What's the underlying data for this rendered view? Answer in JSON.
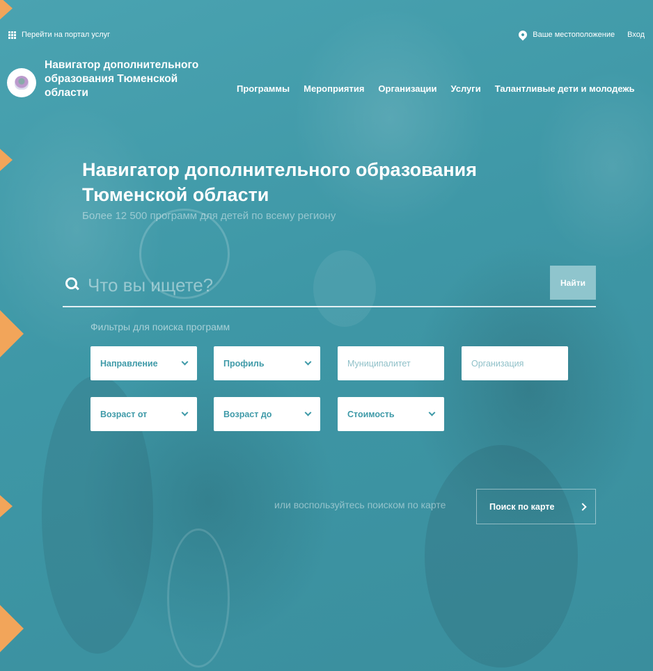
{
  "topbar": {
    "portal_link": "Перейти на портал услуг",
    "location": "Ваше местоположение",
    "login": "Вход"
  },
  "header": {
    "brand": "Навигатор дополнительного образования Тюменской области",
    "nav": [
      "Программы",
      "Мероприятия",
      "Организации",
      "Услуги",
      "Талантливые дети и молодежь"
    ]
  },
  "hero": {
    "title": "Навигатор дополнительного образования Тюменской области",
    "subtitle": "Более 12 500 программ для детей по всему региону"
  },
  "search": {
    "placeholder": "Что вы ищете?",
    "button": "Найти"
  },
  "filters": {
    "label": "Фильтры для поиска программ",
    "direction": "Направление",
    "profile": "Профиль",
    "municipality": "Муниципалитет",
    "organization": "Организация",
    "age_from": "Возраст от",
    "age_to": "Возраст до",
    "cost": "Стоимость"
  },
  "map": {
    "hint": "или воспользуйтесь поиском по карте",
    "button": "Поиск по карте"
  },
  "colors": {
    "accent": "#3f9aa8",
    "marker": "#f2a55a"
  }
}
